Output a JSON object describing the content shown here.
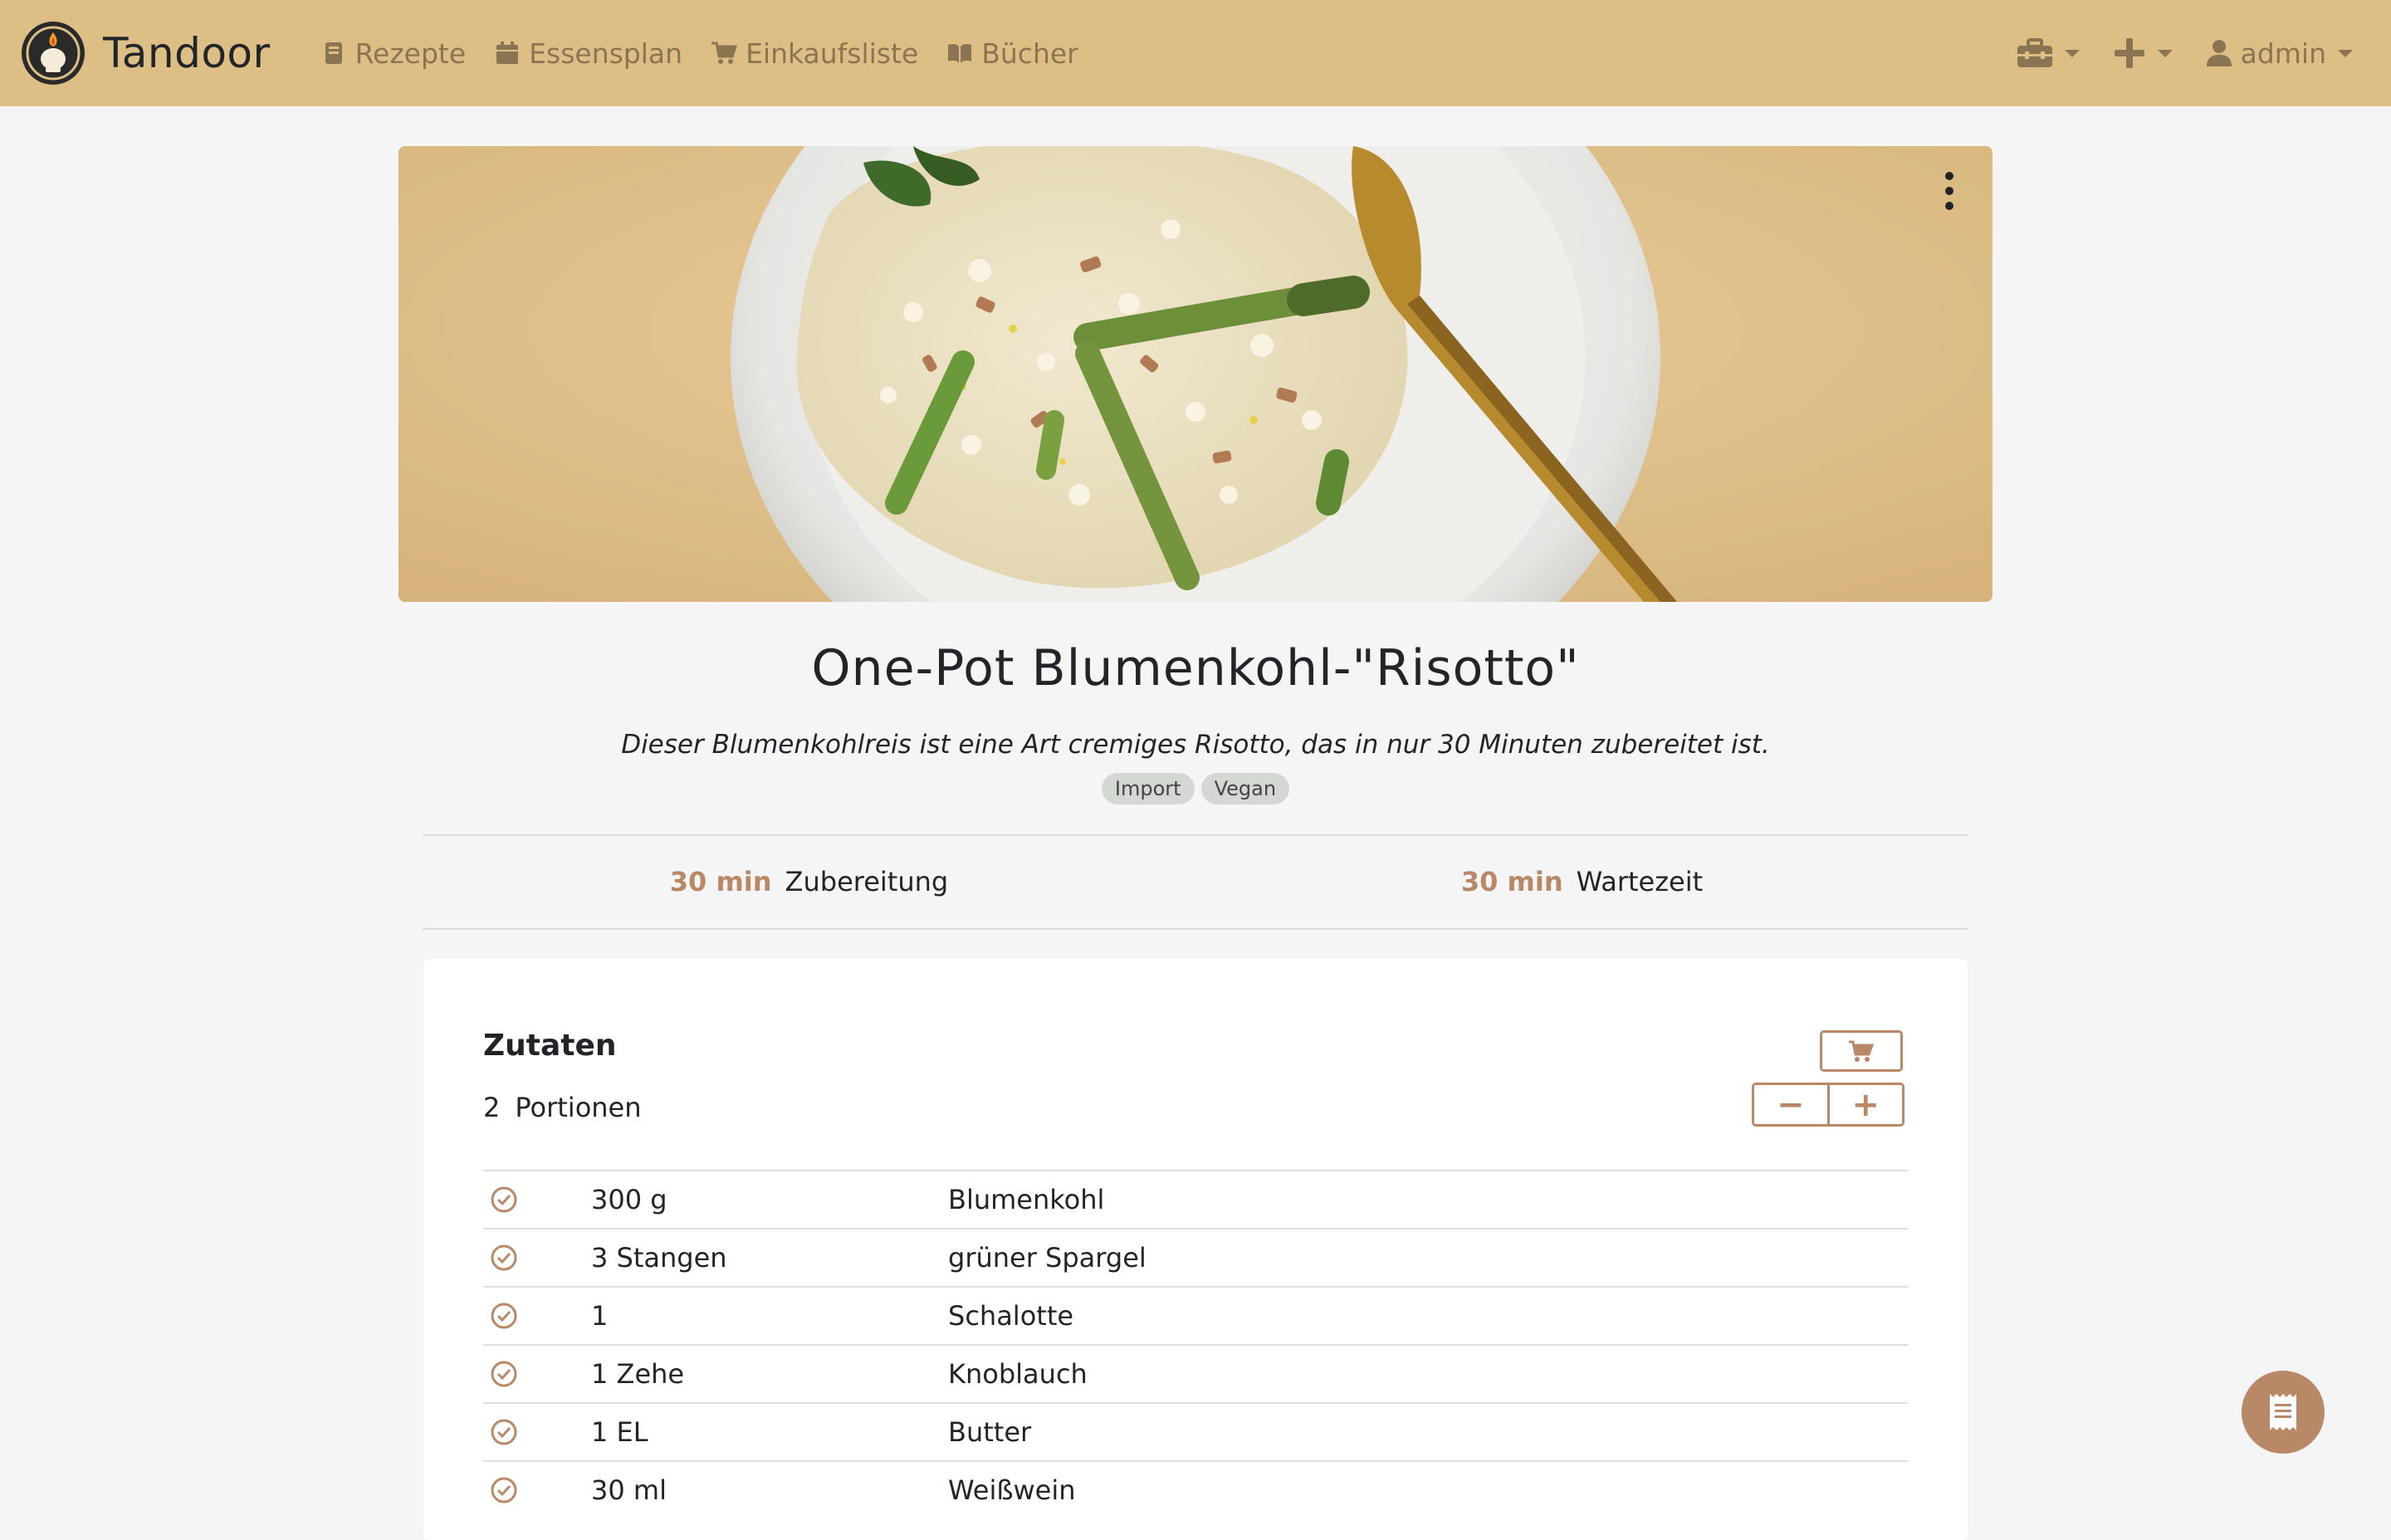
{
  "navbar": {
    "brand": "Tandoor",
    "links": [
      {
        "label": "Rezepte",
        "icon": "book-icon"
      },
      {
        "label": "Essensplan",
        "icon": "calendar-icon"
      },
      {
        "label": "Einkaufsliste",
        "icon": "cart-icon"
      },
      {
        "label": "Bücher",
        "icon": "open-book-icon"
      }
    ],
    "user": "admin",
    "colors": {
      "bar": "#ddbf86",
      "link": "#8a7553"
    }
  },
  "recipe": {
    "title": "One-Pot Blumenkohl-\"Risotto\"",
    "description": "Dieser Blumenkohlreis ist eine Art cremiges Risotto, das in nur 30 Minuten zubereitet ist.",
    "keywords": [
      "Import",
      "Vegan"
    ],
    "times": [
      {
        "value": "30 min",
        "label": "Zubereitung"
      },
      {
        "value": "30 min",
        "label": "Wartezeit"
      }
    ]
  },
  "ingredients": {
    "title": "Zutaten",
    "servings": "2",
    "servings_label": "Portionen",
    "minus": "−",
    "plus": "+",
    "rows": [
      {
        "amount": "300 g",
        "name": "Blumenkohl"
      },
      {
        "amount": "3 Stangen",
        "name": "grüner Spargel"
      },
      {
        "amount": "1",
        "name": "Schalotte"
      },
      {
        "amount": "1 Zehe",
        "name": "Knoblauch"
      },
      {
        "amount": "1 EL",
        "name": "Butter"
      },
      {
        "amount": "30 ml",
        "name": "Weißwein"
      }
    ]
  },
  "accent": "#b98866"
}
